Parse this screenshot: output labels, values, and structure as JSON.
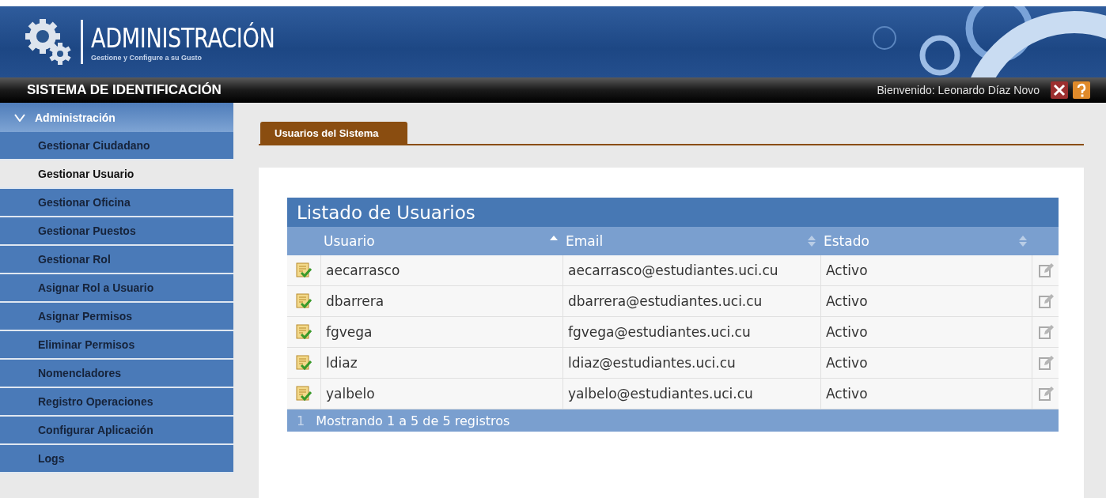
{
  "header": {
    "title": "ADMINISTRACIÓN",
    "subtitle": "Gestione y Configure a su Gusto"
  },
  "topbar": {
    "system": "SISTEMA DE IDENTIFICACIÓN",
    "welcome": "Bienvenido: Leonardo Díaz Novo"
  },
  "sidebar": {
    "section": {
      "label": "Administración",
      "expanded": true
    },
    "items": [
      {
        "label": "Gestionar Ciudadano",
        "selected": false
      },
      {
        "label": "Gestionar Usuario",
        "selected": true
      },
      {
        "label": "Gestionar Oficina",
        "selected": false
      },
      {
        "label": "Gestionar Puestos",
        "selected": false
      },
      {
        "label": "Gestionar Rol",
        "selected": false
      },
      {
        "label": "Asignar Rol a Usuario",
        "selected": false
      },
      {
        "label": "Asignar Permisos",
        "selected": false
      },
      {
        "label": "Eliminar Permisos",
        "selected": false
      },
      {
        "label": "Nomencladores",
        "selected": false
      },
      {
        "label": "Registro Operaciones",
        "selected": false
      },
      {
        "label": "Configurar Aplicación",
        "selected": false
      },
      {
        "label": "Logs",
        "selected": false
      }
    ]
  },
  "tabs": [
    {
      "label": "Usuarios del Sistema",
      "selected": true
    }
  ],
  "table": {
    "title": "Listado de Usuarios",
    "columns": [
      {
        "label": "Usuario",
        "sorted": true
      },
      {
        "label": "Email",
        "sorted": false
      },
      {
        "label": "Estado",
        "sorted": false
      }
    ],
    "rows": [
      {
        "cells": [
          "aecarrasco",
          "aecarrasco@estudiantes.uci.cu",
          "Activo"
        ]
      },
      {
        "cells": [
          "dbarrera",
          "dbarrera@estudiantes.uci.cu",
          "Activo"
        ]
      },
      {
        "cells": [
          "fgvega",
          "fgvega@estudiantes.uci.cu",
          "Activo"
        ]
      },
      {
        "cells": [
          "ldiaz",
          "ldiaz@estudiantes.uci.cu",
          "Activo"
        ]
      },
      {
        "cells": [
          "yalbelo",
          "yalbelo@estudiantes.uci.cu",
          "Activo"
        ]
      }
    ],
    "footer": {
      "page": "1",
      "info": "Mostrando 1 a 5 de 5 registros"
    }
  }
}
